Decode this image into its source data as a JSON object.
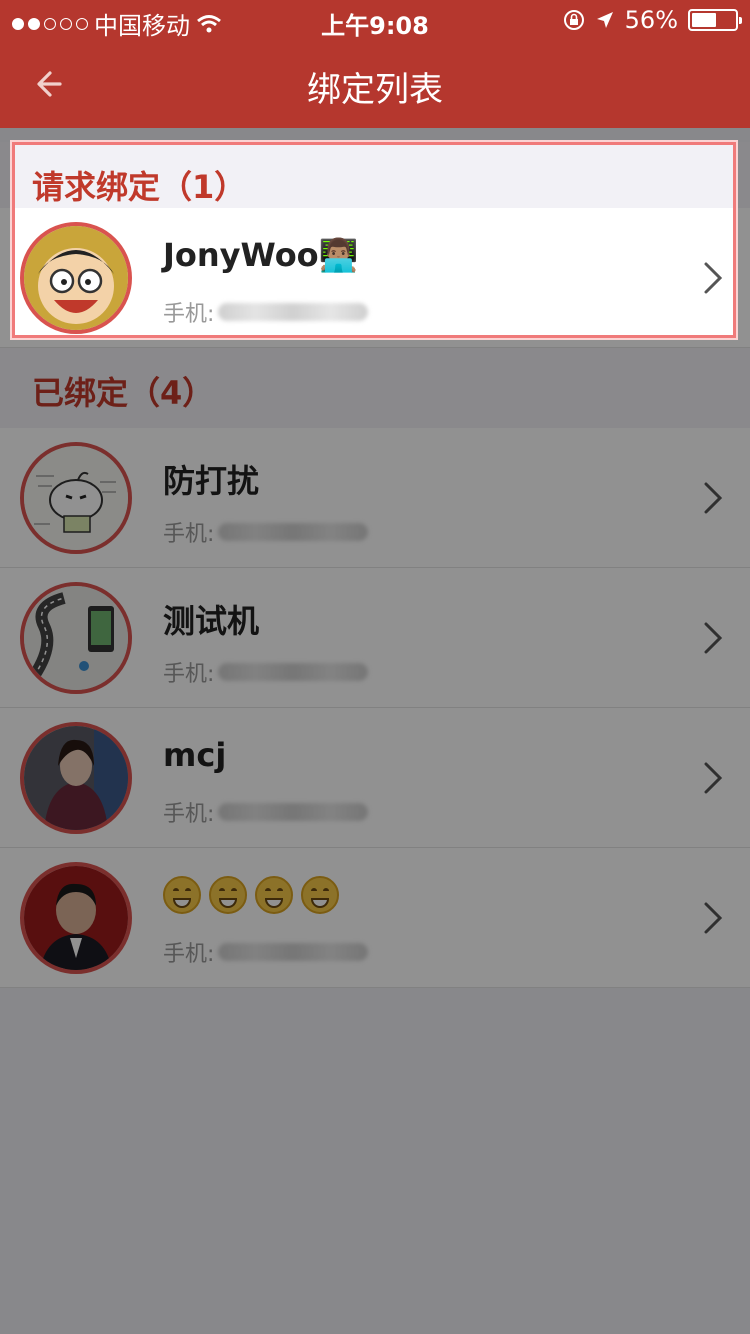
{
  "status_bar": {
    "carrier": "中国移动",
    "time": "上午9:08",
    "battery_percent": "56%",
    "battery_level": 0.56,
    "signal_dots_filled": 2,
    "signal_dots_total": 5
  },
  "navbar": {
    "title": "绑定列表",
    "back_icon": "back-arrow-icon"
  },
  "sections": {
    "pending": {
      "label": "请求绑定（1）",
      "rows": [
        {
          "name": "JonyWoo👨🏽‍💻",
          "phone_label": "手机:"
        }
      ]
    },
    "bound": {
      "label": "已绑定（4）",
      "rows": [
        {
          "name": "防打扰",
          "phone_label": "手机:"
        },
        {
          "name": "测试机",
          "phone_label": "手机:"
        },
        {
          "name": "mcj",
          "phone_label": "手机:"
        },
        {
          "name": "😁😁😁😁",
          "phone_label": "手机:"
        }
      ]
    }
  },
  "colors": {
    "accent": "#b5372e",
    "section_label": "#c0392b",
    "highlight": "#f07a7a"
  }
}
